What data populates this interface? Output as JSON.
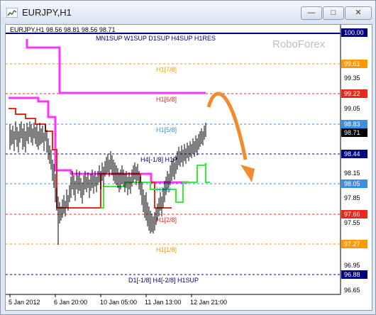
{
  "window": {
    "title": "EURJPY,H1",
    "minimize_glyph": "—",
    "maximize_glyph": "□",
    "close_glyph": "✕"
  },
  "chart": {
    "info_line": "EURJPY,H1  98.56 98.81 98.56 98.71",
    "watermark": "RoboForex",
    "top_label": "MN1SUP W1SUP D1SUP H4SUP H1RES",
    "bottom_label": "D1[-1/8] H4[-2/8] H1SUP",
    "price_labels": [
      "100.00",
      "99.61",
      "99.35",
      "99.22",
      "99.05",
      "98.83",
      "98.71",
      "98.44",
      "98.15",
      "98.05",
      "97.85",
      "97.66",
      "97.55",
      "97.27",
      "96.95",
      "96.88",
      "96.65"
    ],
    "time_labels": [
      "5 Jan 2012",
      "6 Jan 20:00",
      "10 Jan 05:00",
      "11 Jan 13:00",
      "12 Jan 21:00"
    ],
    "level_labels": {
      "h1_7_8": "H1[7/8]",
      "h1_6_8": "H1[6/8]",
      "h1_5_8": "H1[5/8]",
      "h4_m1_8": "H4[-1/8] H1P",
      "h1_3_8": "H1[3/",
      "h1_2_8": "H1[2/8]",
      "h1_1_8": "H1[1/8]"
    },
    "colors": {
      "navy": "#000080",
      "orange": "#ff9900",
      "red": "#e8291c",
      "blue": "#3b8fe0",
      "magenta": "#ff33ff",
      "green": "#33ee33",
      "arrow": "#f58a2c"
    }
  },
  "chart_data": {
    "type": "line",
    "title": "EURJPY,H1",
    "ylim": [
      96.6,
      100.05
    ],
    "levels": [
      {
        "price": 100.0,
        "label": "MN1SUP W1SUP D1SUP H4SUP H1RES",
        "color": "#000080"
      },
      {
        "price": 99.61,
        "label": "H1[7/8]",
        "color": "#ff9900"
      },
      {
        "price": 99.22,
        "label": "H1[6/8]",
        "color": "#e8291c"
      },
      {
        "price": 98.83,
        "label": "H1[5/8]",
        "color": "#3b8fe0"
      },
      {
        "price": 98.44,
        "label": "H4[-1/8] H1P",
        "color": "#000080"
      },
      {
        "price": 98.05,
        "label": "H1[3/",
        "color": "#3b8fe0"
      },
      {
        "price": 97.66,
        "label": "H1[2/8]",
        "color": "#e8291c"
      },
      {
        "price": 97.27,
        "label": "H1[1/8]",
        "color": "#ff9900"
      },
      {
        "price": 96.88,
        "label": "D1[-1/8] H4[-2/8] H1SUP",
        "color": "#000080"
      }
    ],
    "last_price": 98.71
  }
}
